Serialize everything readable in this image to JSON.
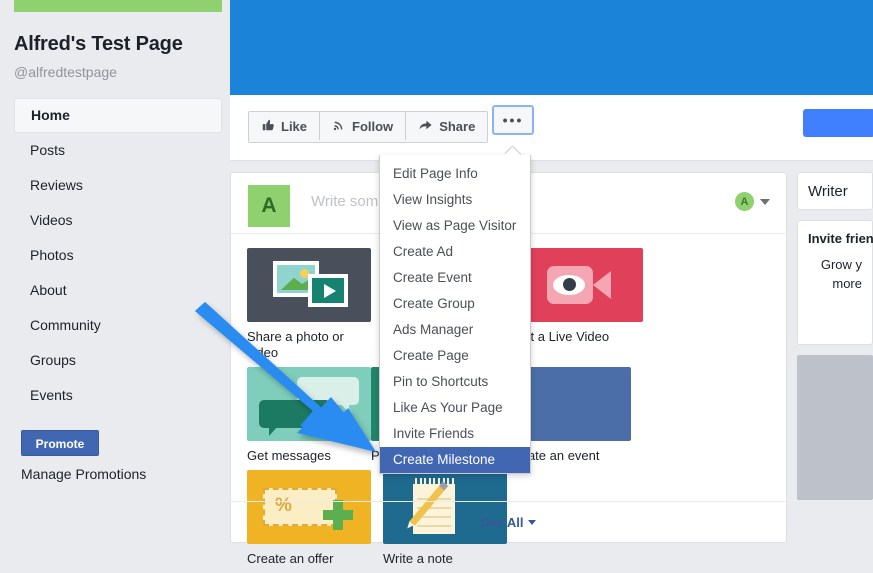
{
  "page": {
    "title": "Alfred's Test Page",
    "handle": "@alfredtestpage"
  },
  "sidebar": {
    "items": [
      {
        "label": "Home",
        "active": true
      },
      {
        "label": "Posts",
        "active": false
      },
      {
        "label": "Reviews",
        "active": false
      },
      {
        "label": "Videos",
        "active": false
      },
      {
        "label": "Photos",
        "active": false
      },
      {
        "label": "About",
        "active": false
      },
      {
        "label": "Community",
        "active": false
      },
      {
        "label": "Groups",
        "active": false
      },
      {
        "label": "Events",
        "active": false
      }
    ],
    "promote_label": "Promote",
    "manage_promotions_label": "Manage Promotions"
  },
  "action_bar": {
    "like_label": "Like",
    "follow_label": "Follow",
    "share_label": "Share",
    "more_label": "•••"
  },
  "composer": {
    "avatar_initial": "A",
    "placeholder": "Write som",
    "badge_initial": "A"
  },
  "tiles": [
    {
      "label": "Share a photo or video",
      "art": "photo"
    },
    {
      "label": "",
      "art": "hidden1"
    },
    {
      "label": "art a Live Video",
      "art": "live"
    },
    {
      "label": "Get messages",
      "art": "messages"
    },
    {
      "label": "Publish a job post",
      "art": "job"
    },
    {
      "label": "Create an event",
      "art": "event"
    },
    {
      "label": "Create an offer",
      "art": "offer"
    },
    {
      "label": "Write a note",
      "art": "note"
    }
  ],
  "see_all_label": "See All",
  "menu": {
    "items": [
      {
        "label": "Edit Page Info",
        "selected": false
      },
      {
        "label": "View Insights",
        "selected": false
      },
      {
        "label": "View as Page Visitor",
        "selected": false
      },
      {
        "label": "Create Ad",
        "selected": false
      },
      {
        "label": "Create Event",
        "selected": false
      },
      {
        "label": "Create Group",
        "selected": false
      },
      {
        "label": "Ads Manager",
        "selected": false
      },
      {
        "label": "Create Page",
        "selected": false
      },
      {
        "label": "Pin to Shortcuts",
        "selected": false
      },
      {
        "label": "Like As Your Page",
        "selected": false
      },
      {
        "label": "Invite Friends",
        "selected": false
      },
      {
        "label": "Create Milestone",
        "selected": true
      }
    ]
  },
  "right_sidebar": {
    "writer_label": "Writer",
    "invite_title": "Invite friend",
    "invite_body_line1": "Grow y",
    "invite_body_line2": "more"
  },
  "offer_tile": {
    "percent_glyph": "%"
  },
  "colors": {
    "cover_blue": "#1b84d8",
    "accent_blue": "#4267b2",
    "link_blue": "#385898",
    "arrow_blue": "#2a8cf0",
    "page_bg": "#e9ebee",
    "green_avatar": "#8ed16e"
  }
}
